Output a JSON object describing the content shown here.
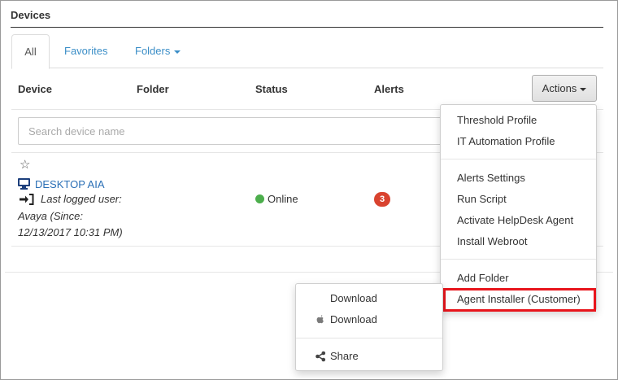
{
  "panel": {
    "title": "Devices"
  },
  "tabs": [
    {
      "label": "All",
      "active": true
    },
    {
      "label": "Favorites",
      "active": false
    },
    {
      "label": "Folders",
      "active": false,
      "dropdown": true
    }
  ],
  "table": {
    "columns": [
      "Device",
      "Folder",
      "Status",
      "Alerts"
    ],
    "actions_label": "Actions"
  },
  "search": {
    "placeholder": "Search device name",
    "value": ""
  },
  "device": {
    "name": "DESKTOP AIA",
    "last_logged_label": "Last logged user:",
    "user_line": "Avaya (Since:",
    "since_line": "12/13/2017 10:31 PM)",
    "status": "Online",
    "status_color": "#4cae4c",
    "alerts": "3",
    "alert_color": "#d9432f"
  },
  "actions_menu": {
    "groups": [
      [
        "Threshold Profile",
        "IT Automation Profile"
      ],
      [
        "Alerts Settings",
        "Run Script",
        "Activate HelpDesk Agent",
        "Install Webroot"
      ],
      [
        "Add Folder",
        "Agent Installer (Customer)"
      ]
    ],
    "highlighted_item": "Agent Installer (Customer)",
    "highlight_color": "#e8151c"
  },
  "installer_menu": {
    "items": [
      {
        "label": "Download",
        "icon": "windows-icon"
      },
      {
        "label": "Download",
        "icon": "apple-icon"
      },
      {
        "label": "Share",
        "icon": "share-icon"
      }
    ]
  },
  "colors": {
    "link": "#3b8ec7",
    "device_link": "#2a6fb6",
    "monitor": "#1d3f7c"
  }
}
